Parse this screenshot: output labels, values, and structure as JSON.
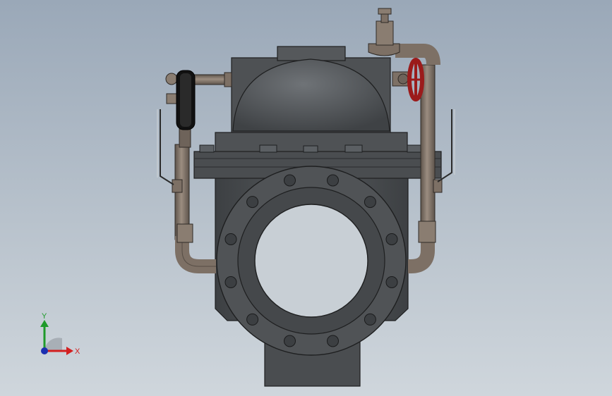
{
  "viewport": {
    "background_top": "#9aa8b8",
    "background_bottom": "#cfd6dc"
  },
  "model": {
    "body_color": "#4b4e51",
    "pipe_color": "#7d7065",
    "handwheel_color": "#9b1b1b",
    "gauge_color": "#111111"
  },
  "triad": {
    "x_label": "X",
    "y_label": "Y",
    "x_color": "#d32020",
    "y_color": "#1f9a2a",
    "z_color": "#1c2fb0"
  }
}
